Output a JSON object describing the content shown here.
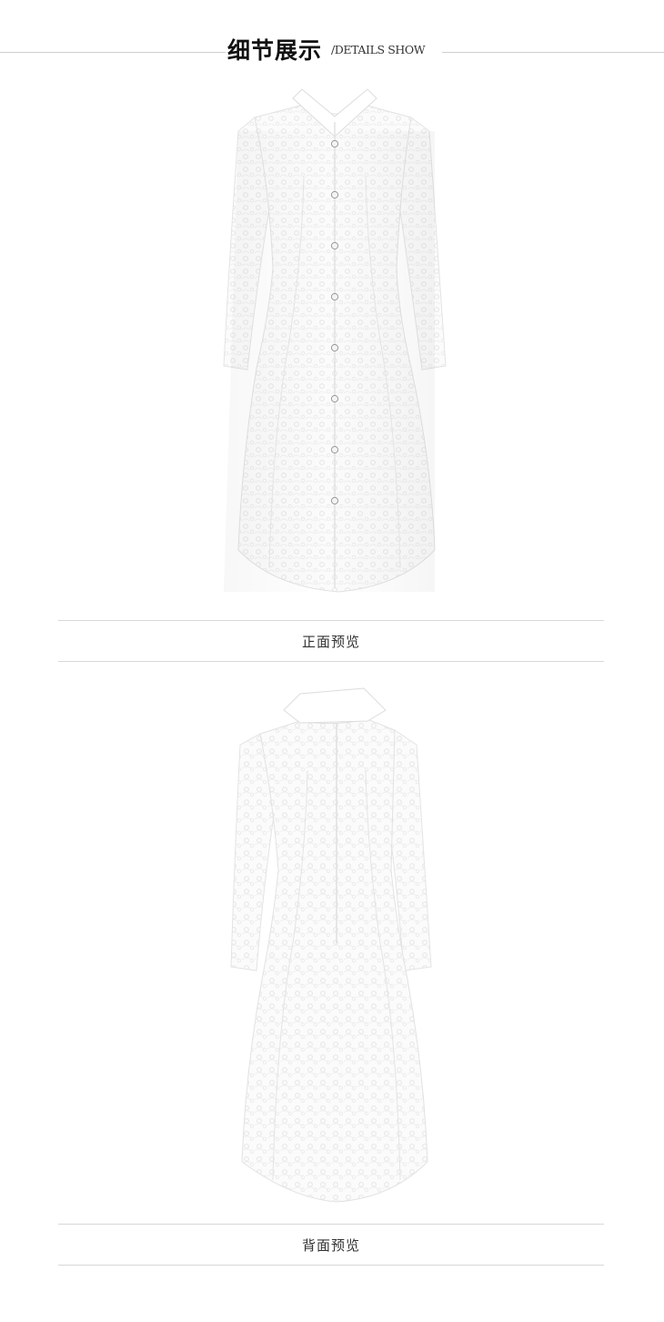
{
  "header": {
    "title": "细节展示",
    "subtitle": "/DETAILS SHOW"
  },
  "sections": [
    {
      "caption": "正面预览",
      "view": "front"
    },
    {
      "caption": "背面预览",
      "view": "back"
    }
  ],
  "colors": {
    "dress": "#fafafa",
    "lace_shadow": "#e9e9e9",
    "rule": "#d8d8d8"
  }
}
